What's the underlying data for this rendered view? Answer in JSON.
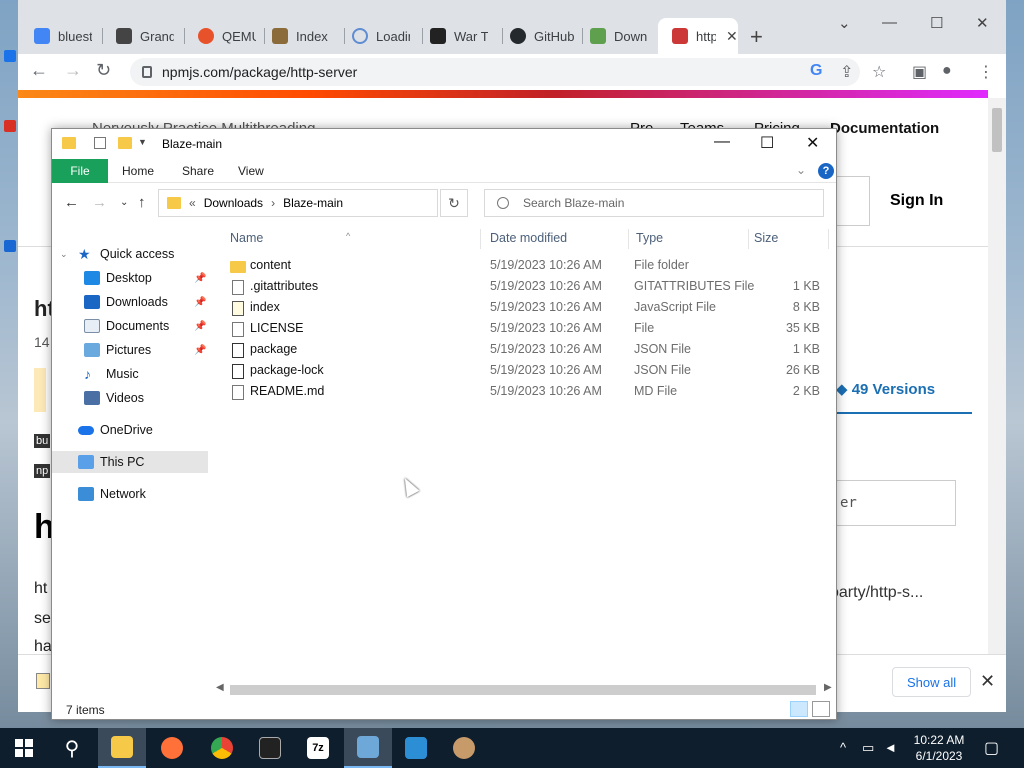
{
  "browser": {
    "tabs": [
      {
        "label": "bluesta",
        "icon": "google-icon",
        "color": "#4285f4"
      },
      {
        "label": "Grand",
        "icon": "building-icon",
        "color": "#444444"
      },
      {
        "label": "QEMU",
        "icon": "qemu-icon",
        "color": "#e8522b"
      },
      {
        "label": "Index o",
        "icon": "puzzle-icon",
        "color": "#8b6b3a"
      },
      {
        "label": "Loadin",
        "icon": "spinner-icon",
        "color": "#5f8dd3"
      },
      {
        "label": "War Th",
        "icon": "bug-icon",
        "color": "#222222"
      },
      {
        "label": "GitHub",
        "icon": "github-icon",
        "color": "#24292e"
      },
      {
        "label": "Downlo",
        "icon": "nodejs-icon",
        "color": "#5fa04e"
      },
      {
        "label": "http",
        "icon": "npm-icon",
        "color": "#cb3837"
      }
    ],
    "url": "npmjs.com/package/http-server"
  },
  "npm_page": {
    "header_text": "Nervously Practice Multithreading",
    "header_links": [
      "Pro",
      "Teams",
      "Pricing"
    ],
    "documentation": "Documentation",
    "sign_in": "Sign In",
    "title_partial": "ht",
    "sub_partial": "14",
    "tag1": "bu",
    "tag2": "np",
    "big_heading_partial": "h",
    "para_lines": [
      "ht",
      "se",
      "ha"
    ],
    "versions": "49 Versions",
    "install_partial": "er",
    "repo_partial": "oarty/http-s..."
  },
  "downloads_bar": {
    "show_all": "Show all"
  },
  "explorer": {
    "title": "Blaze-main",
    "ribbon_tabs": [
      "File",
      "Home",
      "Share",
      "View"
    ],
    "breadcrumb": [
      "Downloads",
      "Blaze-main"
    ],
    "search_placeholder": "Search Blaze-main",
    "nav": {
      "quick_access": "Quick access",
      "items": [
        "Desktop",
        "Downloads",
        "Documents",
        "Pictures",
        "Music",
        "Videos"
      ],
      "onedrive": "OneDrive",
      "this_pc": "This PC",
      "network": "Network"
    },
    "columns": {
      "name": "Name",
      "date": "Date modified",
      "type": "Type",
      "size": "Size"
    },
    "files": [
      {
        "name": "content",
        "date": "5/19/2023 10:26 AM",
        "type": "File folder",
        "size": "",
        "icon": "folder-icon"
      },
      {
        "name": ".gitattributes",
        "date": "5/19/2023 10:26 AM",
        "type": "GITATTRIBUTES File",
        "size": "1 KB",
        "icon": "file-icon"
      },
      {
        "name": "index",
        "date": "5/19/2023 10:26 AM",
        "type": "JavaScript File",
        "size": "8 KB",
        "icon": "js-file-icon"
      },
      {
        "name": "LICENSE",
        "date": "5/19/2023 10:26 AM",
        "type": "File",
        "size": "35 KB",
        "icon": "file-icon"
      },
      {
        "name": "package",
        "date": "5/19/2023 10:26 AM",
        "type": "JSON File",
        "size": "1 KB",
        "icon": "json-file-icon"
      },
      {
        "name": "package-lock",
        "date": "5/19/2023 10:26 AM",
        "type": "JSON File",
        "size": "26 KB",
        "icon": "json-file-icon"
      },
      {
        "name": "README.md",
        "date": "5/19/2023 10:26 AM",
        "type": "MD File",
        "size": "2 KB",
        "icon": "file-icon"
      }
    ],
    "status": "7 items"
  },
  "taskbar": {
    "time": "10:22 AM",
    "date": "6/1/2023"
  }
}
